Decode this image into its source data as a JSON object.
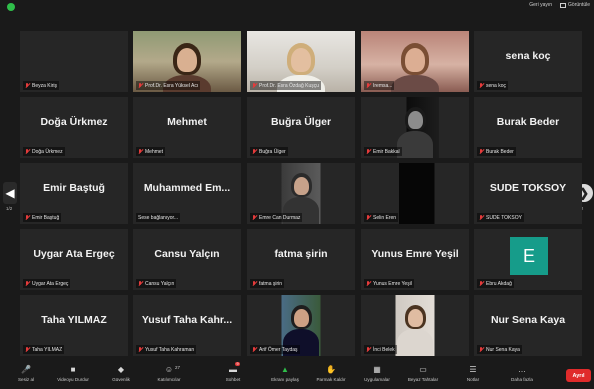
{
  "window": {
    "top_items": [
      "Geri yayın",
      "Görüntüle"
    ]
  },
  "tiles": [
    {
      "name": "",
      "label": "Beyza Kiriş",
      "type": "text"
    },
    {
      "name": "",
      "label": "Prof.Dr. Esra Yüksel Acı",
      "type": "photo",
      "active": true
    },
    {
      "name": "",
      "label": "Prof.Dr. Esra Özdağ Kuşçu",
      "type": "photo"
    },
    {
      "name": "",
      "label": "Iremsa...",
      "type": "photo"
    },
    {
      "name": "sena koç",
      "label": "sena koç",
      "type": "text"
    },
    {
      "name": "Doğa Ürkmez",
      "label": "Doğa Ürkmez",
      "type": "text"
    },
    {
      "name": "Mehmet",
      "label": "Mehmet",
      "type": "text"
    },
    {
      "name": "Buğra Ülger",
      "label": "Buğra Ülger",
      "type": "text"
    },
    {
      "name": "",
      "label": "Emir Bakkal",
      "type": "photo"
    },
    {
      "name": "Burak Beder",
      "label": "Burak Beder",
      "type": "text"
    },
    {
      "name": "Emir Baştuğ",
      "label": "Emir Baştuğ",
      "type": "text"
    },
    {
      "name": "Muhammed  Em...",
      "label": "Sese bağlanıyor...",
      "type": "text"
    },
    {
      "name": "",
      "label": "Emre Can Durmaz",
      "type": "photo"
    },
    {
      "name": "",
      "label": "Selin Eren",
      "type": "photo"
    },
    {
      "name": "SUDE TOKSOY",
      "label": "SUDE TOKSOY",
      "type": "text"
    },
    {
      "name": "Uygar Ata Ergeç",
      "label": "Uygar Ata Ergeç",
      "type": "text"
    },
    {
      "name": "Cansu Yalçın",
      "label": "Cansu Yalçın",
      "type": "text"
    },
    {
      "name": "fatma şirin",
      "label": "fatma şirin",
      "type": "text"
    },
    {
      "name": "Yunus Emre Yeşil",
      "label": "Yunus Emre Yeşil",
      "type": "text"
    },
    {
      "name": "E",
      "label": "Ebru Akdağ",
      "type": "avatar"
    },
    {
      "name": "Taha YILMAZ",
      "label": "Taha YILMAZ",
      "type": "text"
    },
    {
      "name": "Yusuf Taha Kahr...",
      "label": "Yusuf Taha Kahraman",
      "type": "text"
    },
    {
      "name": "",
      "label": "Arif Ömer Taydaş",
      "type": "photo"
    },
    {
      "name": "",
      "label": "İnci Belek",
      "type": "photo"
    },
    {
      "name": "Nur Sena Kaya",
      "label": "Nur Sena Kaya",
      "type": "text"
    }
  ],
  "pages": {
    "left": "1/2",
    "right": "2/2"
  },
  "toolbar": {
    "items": [
      {
        "label": "Sesiz al",
        "icon": "microphone-icon"
      },
      {
        "label": "Videoyu Durdur",
        "icon": "video-icon"
      },
      {
        "label": "Güvenlik",
        "icon": "security-icon"
      },
      {
        "label": "Katılımcılar",
        "icon": "participants-icon",
        "count": "27"
      },
      {
        "label": "Sohbet",
        "icon": "chat-icon",
        "badge": "9"
      },
      {
        "label": "Ekranı paylaş",
        "icon": "share-screen-icon"
      },
      {
        "label": "Parmak Kaldır",
        "icon": "raise-hand-icon"
      },
      {
        "label": "Uygulamalar",
        "icon": "apps-icon"
      },
      {
        "label": "Beyaz Tahtalar",
        "icon": "whiteboard-icon"
      },
      {
        "label": "Notlar",
        "icon": "notes-icon"
      },
      {
        "label": "Daha fazla",
        "icon": "more-icon"
      }
    ],
    "leave_label": "Ayrıl"
  },
  "colors": {
    "active_speaker_border": "#e8e400",
    "mic_muted": "#e63b3b",
    "leave_button": "#e02b2b",
    "avatar_e": "#169c8a"
  }
}
